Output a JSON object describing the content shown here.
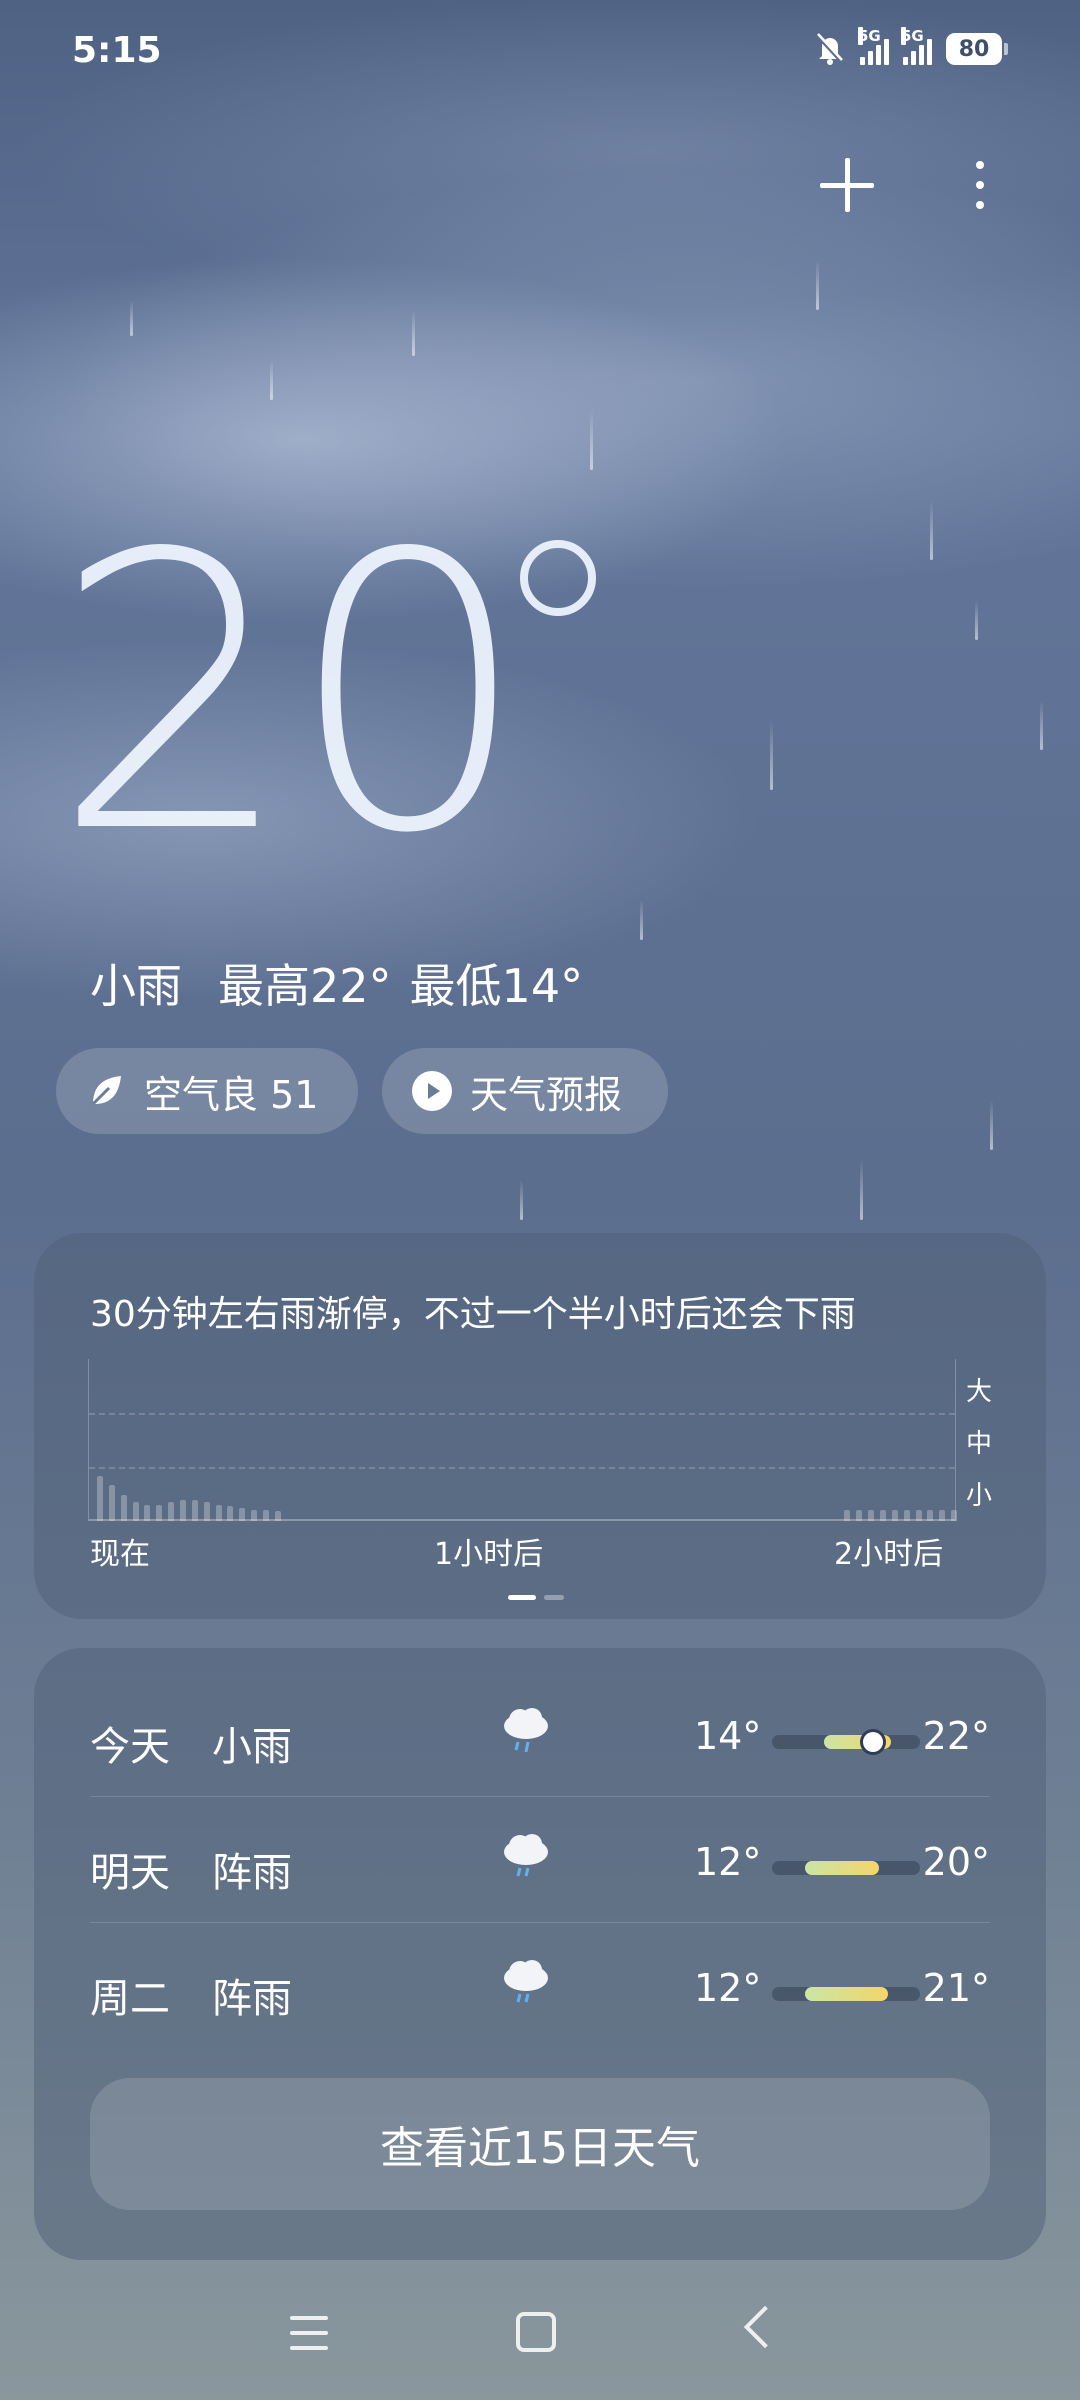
{
  "status_bar": {
    "time": "5:15",
    "battery": "80",
    "network_labels": [
      "5G",
      "5G"
    ]
  },
  "actions": {
    "add_icon": "plus-icon",
    "more_icon": "more-vertical-icon"
  },
  "current": {
    "temperature": "20",
    "condition": "小雨",
    "high": "最高22°",
    "low": "最低14°"
  },
  "chips": {
    "air_quality": "空气良 51",
    "air_icon": "leaf-icon",
    "forecast_video": "天气预报",
    "video_icon": "play-icon"
  },
  "rain_card": {
    "title": "30分钟左右雨渐停，不过一个半小时后还会下雨",
    "y_labels": [
      "大",
      "中",
      "小"
    ],
    "x_labels": [
      "现在",
      "1小时后",
      "2小时后"
    ],
    "bars_level": [
      0.28,
      0.22,
      0.16,
      0.12,
      0.1,
      0.1,
      0.12,
      0.13,
      0.13,
      0.12,
      0.1,
      0.09,
      0.08,
      0.07,
      0.07,
      0.06,
      0,
      0,
      0,
      0,
      0,
      0,
      0,
      0,
      0,
      0,
      0,
      0,
      0,
      0,
      0,
      0,
      0,
      0,
      0,
      0,
      0,
      0,
      0,
      0,
      0,
      0,
      0,
      0,
      0,
      0,
      0,
      0,
      0,
      0,
      0,
      0,
      0,
      0,
      0,
      0,
      0,
      0,
      0,
      0,
      0,
      0,
      0,
      0.07,
      0.07,
      0.07,
      0.07,
      0.07,
      0.07,
      0.07,
      0.07,
      0.07,
      0.07
    ]
  },
  "daily": [
    {
      "day": "今天",
      "condition": "小雨",
      "icon": "cloud-rain-icon",
      "low": "14°",
      "high": "22°",
      "range_start": 0.35,
      "range_end": 0.8,
      "current": 0.68
    },
    {
      "day": "明天",
      "condition": "阵雨",
      "icon": "cloud-rain-icon",
      "low": "12°",
      "high": "20°",
      "range_start": 0.22,
      "range_end": 0.72
    },
    {
      "day": "周二",
      "condition": "阵雨",
      "icon": "cloud-rain-icon",
      "low": "12°",
      "high": "21°",
      "range_start": 0.22,
      "range_end": 0.78
    }
  ],
  "more_button": "查看近15日天气",
  "nav": {
    "menu_icon": "menu-icon",
    "home_icon": "home-icon",
    "back_icon": "back-icon"
  }
}
